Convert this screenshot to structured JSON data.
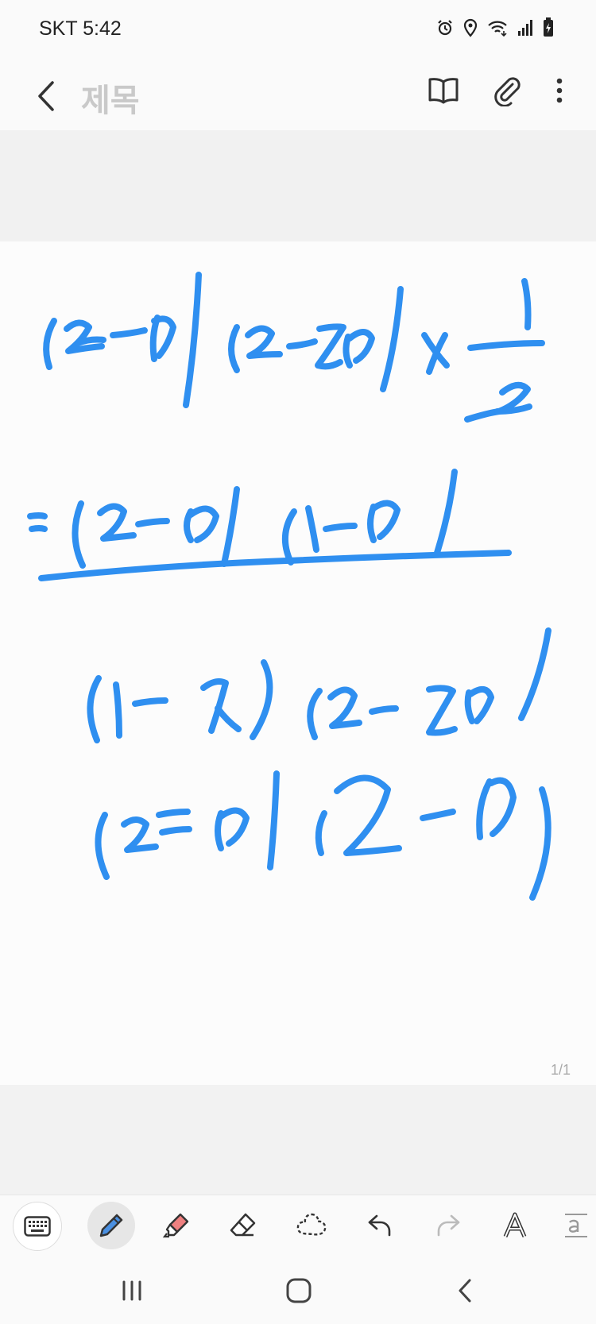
{
  "status": {
    "carrier_time": "SKT 5:42"
  },
  "appbar": {
    "title": "제목"
  },
  "page": {
    "indicator": "1/1"
  },
  "colors": {
    "ink": "#2f8ff0",
    "pen_selected": "#4a90e2",
    "highlighter": "#e05f5f"
  },
  "icons": {
    "status": [
      "alarm-icon",
      "location-icon",
      "wifi-icon",
      "signal-icon",
      "battery-icon"
    ],
    "top_actions": [
      "reading-mode-icon",
      "attach-icon",
      "more-icon"
    ],
    "toolbar": [
      "keyboard-icon",
      "pen-icon",
      "highlighter-icon",
      "eraser-icon",
      "lasso-icon",
      "undo-icon",
      "redo-icon",
      "text-style-icon",
      "text-recognize-icon"
    ],
    "nav": [
      "recent-apps-icon",
      "home-icon",
      "back-icon"
    ]
  }
}
